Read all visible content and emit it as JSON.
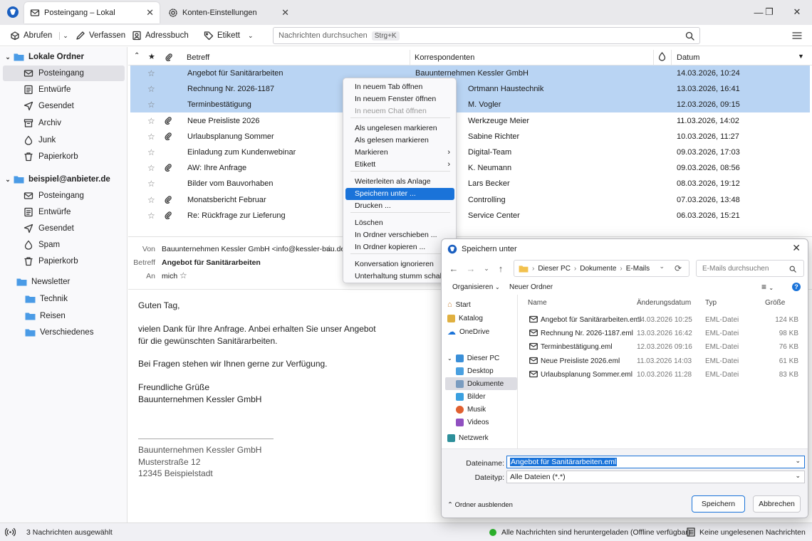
{
  "tabs": [
    {
      "label": "Posteingang – Lokal",
      "icon": "inbox-icon",
      "active": true
    },
    {
      "label": "Konten-Einstellungen",
      "icon": "gear-icon",
      "active": false
    }
  ],
  "window_controls": [
    "minimize-icon",
    "maximize-icon",
    "close-icon"
  ],
  "toolbar": {
    "fetch": "Abrufen",
    "compose": "Verfassen",
    "addressbook": "Adressbuch",
    "tag": "Etikett",
    "search_placeholder": "Nachrichten durchsuchen",
    "search_shortcut": "Strg+K"
  },
  "folders": {
    "local_account": "Lokale Ordner",
    "local": [
      "Posteingang",
      "Entwürfe",
      "Gesendet",
      "Archiv",
      "Junk",
      "Papierkorb"
    ],
    "account2": "beispiel@anbieter.de",
    "account2_folders": [
      "Posteingang",
      "Entwürfe",
      "Gesendet",
      "Spam",
      "Papierkorb"
    ],
    "newsletter": "Newsletter",
    "newsletter_sub": [
      "Technik",
      "Reisen",
      "Verschiedenes"
    ]
  },
  "list": {
    "columns": {
      "subject": "Betreff",
      "correspondents": "Korrespondenten",
      "date": "Datum"
    },
    "rows": [
      {
        "subject": "Angebot für Sanitärarbeiten",
        "from": "Bauunternehmen Kessler GmbH",
        "date": "14.03.2026, 10:24",
        "attachment": false,
        "selected": true
      },
      {
        "subject": "Rechnung Nr. 2026-1187",
        "from": "Ortmann Haustechnik",
        "date": "13.03.2026, 16:41",
        "attachment": false,
        "selected": true
      },
      {
        "subject": "Terminbestätigung",
        "from": "M. Vogler",
        "date": "12.03.2026, 09:15",
        "attachment": false,
        "selected": true
      },
      {
        "subject": "Neue Preisliste 2026",
        "from": "Werkzeuge Meier",
        "date": "11.03.2026, 14:02",
        "attachment": true,
        "selected": false
      },
      {
        "subject": "Urlaubsplanung Sommer",
        "from": "Sabine Richter",
        "date": "10.03.2026, 11:27",
        "attachment": true,
        "selected": false
      },
      {
        "subject": "Einladung zum Kundenwebinar",
        "from": "Digital-Team",
        "date": "09.03.2026, 17:03",
        "attachment": false,
        "selected": false
      },
      {
        "subject": "AW: Ihre Anfrage",
        "from": "K. Neumann",
        "date": "09.03.2026, 08:56",
        "attachment": true,
        "selected": false
      },
      {
        "subject": "Bilder vom Bauvorhaben",
        "from": "Lars Becker",
        "date": "08.03.2026, 19:12",
        "attachment": false,
        "selected": false
      },
      {
        "subject": "Monatsbericht Februar",
        "from": "Controlling",
        "date": "07.03.2026, 13:48",
        "attachment": true,
        "selected": false
      },
      {
        "subject": "Re: Rückfrage zur Lieferung",
        "from": "Service Center",
        "date": "06.03.2026, 15:21",
        "attachment": true,
        "selected": false
      }
    ]
  },
  "preview": {
    "from_label": "Von",
    "from": "Bauunternehmen Kessler GmbH <info@kessler-bau.de>",
    "subject_label": "Betreff",
    "subject": "Angebot für Sanitärarbeiten",
    "to_label": "An",
    "to": "mich",
    "body": [
      "Guten Tag,",
      "vielen Dank für Ihre Anfrage. Anbei erhalten Sie unser Angebot",
      "für die gewünschten Sanitärarbeiten.",
      "Bei Fragen stehen wir Ihnen gerne zur Verfügung.",
      "Freundliche Grüße",
      "Bauunternehmen Kessler GmbH"
    ],
    "signature": [
      "Bauunternehmen Kessler GmbH",
      "Musterstraße 12",
      "12345 Beispielstadt"
    ]
  },
  "context_menu": {
    "items": [
      {
        "label": "In neuem Tab öffnen"
      },
      {
        "label": "In neuem Fenster öffnen"
      },
      {
        "label": "In neuem Chat öffnen",
        "disabled": true
      },
      {
        "label": "Als ungelesen markieren"
      },
      {
        "label": "Als gelesen markieren"
      },
      {
        "label": "Markieren",
        "submenu": true
      },
      {
        "label": "Etikett",
        "submenu": true
      },
      {
        "label": "Weiterleiten als Anlage"
      },
      {
        "label": "Speichern unter ...",
        "highlighted": true
      },
      {
        "label": "Drucken ..."
      },
      {
        "label": "Löschen"
      },
      {
        "label": "In Ordner verschieben ..."
      },
      {
        "label": "In Ordner kopieren ..."
      },
      {
        "label": "Konversation ignorieren"
      },
      {
        "label": "Unterhaltung stumm schalten"
      }
    ]
  },
  "dialog": {
    "title": "Speichern unter",
    "path": [
      "Dieser PC",
      "Dokumente",
      "E-Mails"
    ],
    "search_placeholder": "E-Mails durchsuchen",
    "organize": "Organisieren",
    "new_folder": "Neuer Ordner",
    "nav": {
      "quick": [
        "Start",
        "Katalog",
        "OneDrive"
      ],
      "pc": "Dieser PC",
      "pc_items": [
        "Desktop",
        "Dokumente",
        "Bilder",
        "Musik",
        "Videos"
      ],
      "network": "Netzwerk"
    },
    "columns": {
      "name": "Name",
      "modified": "Änderungsdatum",
      "type": "Typ",
      "size": "Größe"
    },
    "files": [
      {
        "name": "Angebot für Sanitärarbeiten.eml",
        "date": "14.03.2026 10:25",
        "type": "EML-Datei",
        "size": "124 KB"
      },
      {
        "name": "Rechnung Nr. 2026-1187.eml",
        "date": "13.03.2026 16:42",
        "type": "EML-Datei",
        "size": "98 KB"
      },
      {
        "name": "Terminbestätigung.eml",
        "date": "12.03.2026 09:16",
        "type": "EML-Datei",
        "size": "76 KB"
      },
      {
        "name": "Neue Preisliste 2026.eml",
        "date": "11.03.2026 14:03",
        "type": "EML-Datei",
        "size": "61 KB"
      },
      {
        "name": "Urlaubsplanung Sommer.eml",
        "date": "10.03.2026 11:28",
        "type": "EML-Datei",
        "size": "83 KB"
      }
    ],
    "filename_label": "Dateiname:",
    "filename": "Angebot für Sanitärarbeiten.eml",
    "filetype_label": "Dateityp:",
    "filetype": "Alle Dateien (*.*)",
    "hide_folders": "Ordner ausblenden",
    "save": "Speichern",
    "cancel": "Abbrechen"
  },
  "status": {
    "selected": "3 Nachrichten ausgewählt",
    "sync": "Alle Nachrichten sind heruntergeladen (Offline verfügbar)",
    "unread": "Keine ungelesenen Nachrichten"
  },
  "colors": {
    "accent": "#1a73d9",
    "selection": "#b9d4f3",
    "folder": "#4a9be6",
    "online": "#2db32d"
  }
}
